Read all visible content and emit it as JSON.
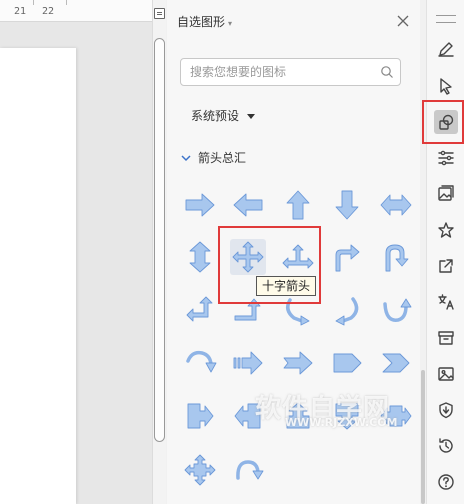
{
  "ruler": {
    "marks": [
      "21",
      "22"
    ]
  },
  "panel": {
    "title": "自选图形",
    "search_placeholder": "搜索您想要的图标",
    "preset_label": "系统预设",
    "category_label": "箭头总汇",
    "tooltip": "十字箭头"
  },
  "shapes": [
    "right-arrow",
    "left-arrow",
    "up-arrow",
    "down-arrow",
    "left-right-arrow",
    "up-down-arrow",
    "quad-arrow",
    "left-right-up-arrow",
    "bent-arrow",
    "u-turn-arrow",
    "left-up-arrow",
    "bent-up-arrow",
    "curved-right-arrow",
    "curved-left-arrow",
    "curved-up-arrow",
    "curved-down-arrow",
    "striped-right-arrow",
    "notched-right-arrow",
    "pentagon",
    "chevron",
    "right-arrow-callout",
    "left-arrow-callout",
    "up-arrow-callout",
    "down-arrow-callout",
    "left-right-arrow-callout",
    "quad-arrow-callout",
    "circular-arrow"
  ],
  "watermark": {
    "main": "软件自学网",
    "sub": "WWW.RJZXW.COM"
  },
  "toolbar": {
    "items": [
      "pen-icon",
      "pointer-icon",
      "shapes-icon",
      "settings-sliders-icon",
      "image-gallery-icon",
      "star-icon",
      "share-icon",
      "translate-icon",
      "archive-icon",
      "picture-icon",
      "shield-icon",
      "history-icon",
      "help-icon"
    ],
    "active": "shapes-icon"
  },
  "colors": {
    "shape_fill": "#a8c7ee",
    "shape_stroke": "#6b98d8",
    "highlight": "#e03a3a",
    "panel_bg": "#f7f7f7"
  }
}
